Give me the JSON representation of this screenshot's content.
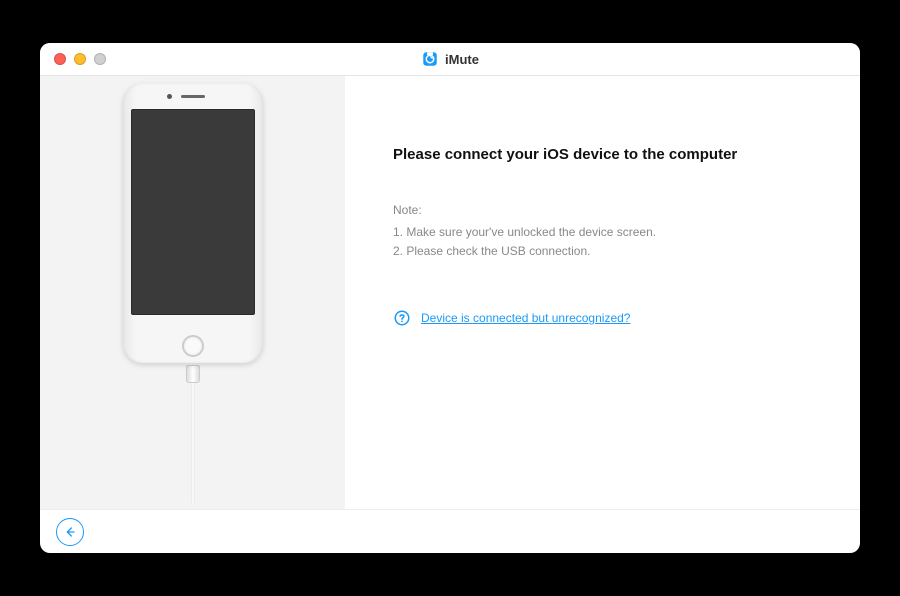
{
  "app": {
    "name": "iMute"
  },
  "main": {
    "heading": "Please connect your iOS device to the computer",
    "noteLabel": "Note:",
    "noteLines": [
      "1. Make sure your've unlocked the device screen.",
      "2. Please check the USB connection."
    ],
    "helpLink": "Device is connected but unrecognized?"
  },
  "colors": {
    "accent": "#1b9af7"
  }
}
